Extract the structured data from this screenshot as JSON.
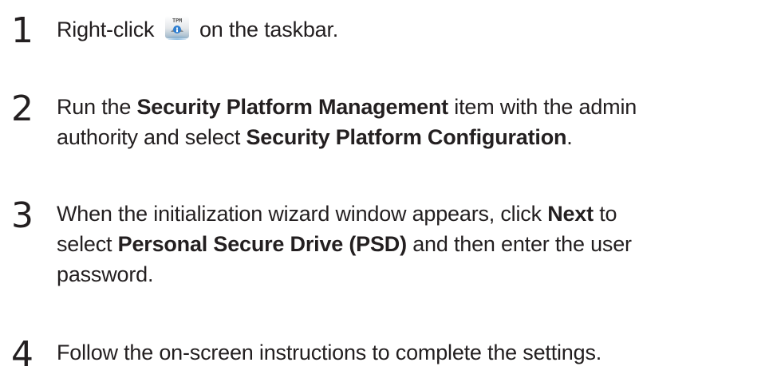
{
  "steps": [
    {
      "number": "1",
      "before_icon": "Right-click",
      "icon": "tpm-tray-icon",
      "icon_text": "TPM",
      "after_icon": "on the taskbar."
    },
    {
      "number": "2",
      "l1_a": "Run the ",
      "l1_b": "Security Platform Management",
      "l1_c": " item with the admin",
      "l2_a": "authority and select ",
      "l2_b": "Security Platform Configuration",
      "l2_c": "."
    },
    {
      "number": "3",
      "l1_a": "When the initialization wizard window appears, click ",
      "l1_b": "Next",
      "l1_c": " to",
      "l2_a": "select ",
      "l2_b": "Personal Secure Drive (PSD)",
      "l2_c": " and then enter the user",
      "l3": "password."
    },
    {
      "number": "4",
      "text": "Follow the on-screen instructions to complete the settings."
    }
  ]
}
